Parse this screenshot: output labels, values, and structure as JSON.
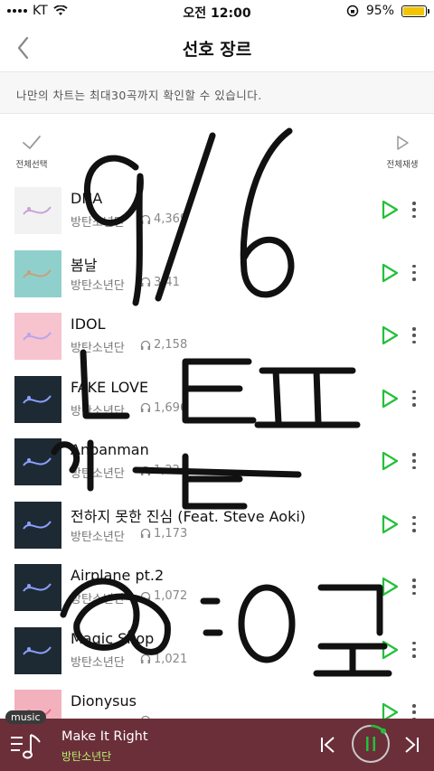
{
  "status_bar": {
    "carrier": "KT",
    "time": "오전 12:00",
    "battery": "95%",
    "battery_level": 0.95
  },
  "header": {
    "title": "선호 장르"
  },
  "info": {
    "text": "나만의 차트는 최대30곡까지 확인할 수 있습니다."
  },
  "toolbar": {
    "select_all": "전체선택",
    "play_all": "전체재생"
  },
  "tracks": [
    {
      "title": "DNA",
      "artist": "방탄소년단",
      "plays": "4,369"
    },
    {
      "title": "봄날",
      "artist": "방탄소년단",
      "plays": "3,41"
    },
    {
      "title": "IDOL",
      "artist": "방탄소년단",
      "plays": "2,158"
    },
    {
      "title": "FAKE LOVE",
      "artist": "방탄소년단",
      "plays": "1,696"
    },
    {
      "title": "Anpanman",
      "artist": "방탄소년단",
      "plays": "1,224"
    },
    {
      "title": "전하지 못한 진심 (Feat. Steve Aoki)",
      "artist": "방탄소년단",
      "plays": "1,173"
    },
    {
      "title": "Airplane pt.2",
      "artist": "방탄소년단",
      "plays": "1,072"
    },
    {
      "title": "Magic Shop",
      "artist": "방탄소년단",
      "plays": "1,021"
    },
    {
      "title": "Dionysus",
      "artist": "방탄소년단",
      "plays": ""
    }
  ],
  "player": {
    "tag": "music",
    "title": "Make It Right",
    "artist": "방탄소년단"
  },
  "colors": {
    "accent_green": "#22c13a",
    "player_bg": "#6b2f3a",
    "artist_green": "#b7f06c",
    "battery_yellow": "#f5c400"
  },
  "icons": [
    "back-chevron-icon",
    "check-icon",
    "play-outline-icon",
    "headphone-icon",
    "more-vertical-icon",
    "music-menu-icon",
    "skip-previous-icon",
    "pause-icon",
    "skip-next-icon",
    "wifi-icon",
    "battery-icon"
  ]
}
